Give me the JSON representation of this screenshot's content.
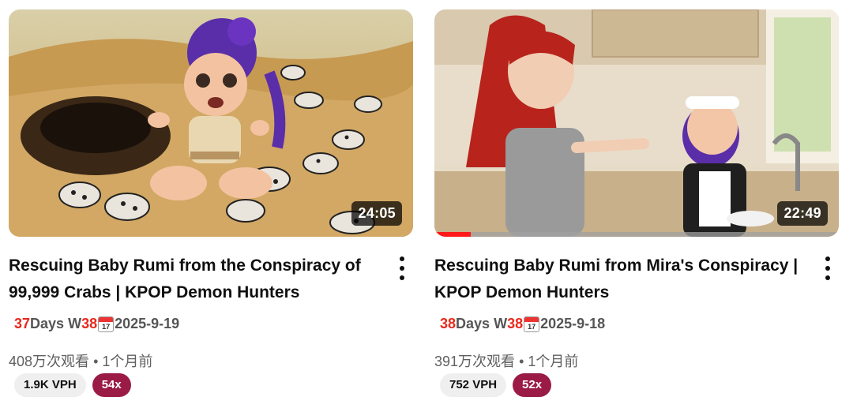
{
  "videos": [
    {
      "title": "Rescuing Baby Rumi from the Conspiracy of 99,999 Crabs | KPOP Demon Hunters",
      "duration": "24:05",
      "watch_progress": 0,
      "stats": {
        "days_value": "37",
        "days_label": "Days W",
        "week_value": "38",
        "date": "2025-9-19"
      },
      "views": "408万次观看",
      "age": "1个月前",
      "vph": "1.9K VPH",
      "multiplier": "54x"
    },
    {
      "title": "Rescuing Baby Rumi from Mira's Conspiracy | KPOP Demon Hunters",
      "duration": "22:49",
      "watch_progress": 0.09,
      "stats": {
        "days_value": "38",
        "days_label": "Days W",
        "week_value": "38",
        "date": "2025-9-18"
      },
      "views": "391万次观看",
      "age": "1个月前",
      "vph": "752 VPH",
      "multiplier": "52x"
    }
  ],
  "calendar_icon_day": "17",
  "meta_separator": "•",
  "colors": {
    "accent_red": "#e8291c",
    "multiplier_chip": "#9b1b47",
    "progress": "#ff1a1a"
  }
}
